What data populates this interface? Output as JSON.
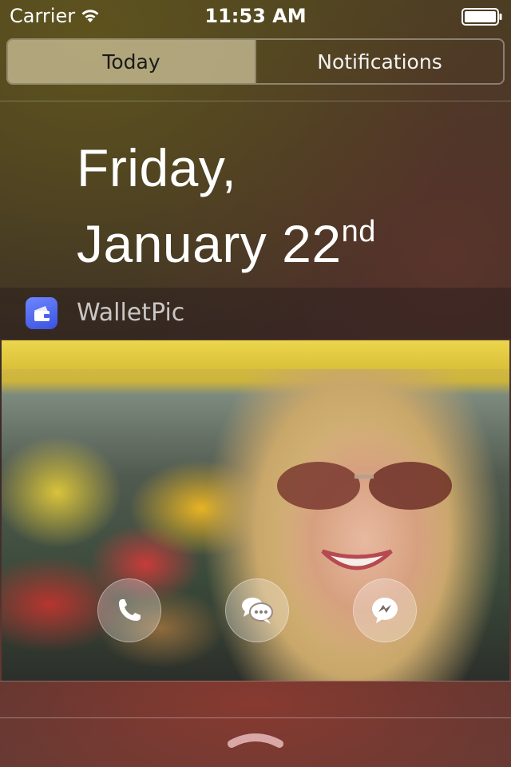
{
  "status_bar": {
    "carrier": "Carrier",
    "time": "11:53 AM",
    "wifi_icon": "wifi-icon",
    "battery_icon": "battery-full-icon"
  },
  "segmented_control": {
    "tabs": [
      {
        "label": "Today",
        "selected": true
      },
      {
        "label": "Notifications",
        "selected": false
      }
    ]
  },
  "date": {
    "weekday": "Friday,",
    "month_day": "January 22",
    "ordinal": "nd"
  },
  "widget": {
    "app_name": "WalletPic",
    "app_icon": "wallet-icon",
    "actions": [
      {
        "name": "call",
        "icon": "phone-icon"
      },
      {
        "name": "message",
        "icon": "chat-bubbles-icon"
      },
      {
        "name": "messenger",
        "icon": "messenger-icon"
      }
    ]
  },
  "colors": {
    "accent_selected_segment": "#d2c8a0",
    "app_icon_blue": "#4a62f0"
  }
}
